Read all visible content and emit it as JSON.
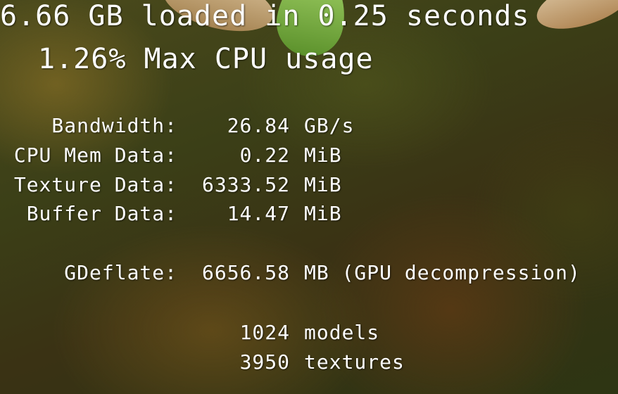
{
  "headline": {
    "loaded_text": "6.66 GB loaded in 0.25 seconds",
    "cpu_text": "1.26% Max CPU usage"
  },
  "stats": [
    {
      "label": "Bandwidth:",
      "value": "26.84",
      "unit": "GB/s"
    },
    {
      "label": "CPU Mem Data:",
      "value": "0.22",
      "unit": "MiB"
    },
    {
      "label": "Texture Data:",
      "value": "6333.52",
      "unit": "MiB"
    },
    {
      "label": "Buffer Data:",
      "value": "14.47",
      "unit": "MiB"
    }
  ],
  "gdeflate": {
    "label": "GDeflate:",
    "value": "6656.58",
    "unit": "MB (GPU decompression)"
  },
  "counts": [
    {
      "value": "1024",
      "unit": "models"
    },
    {
      "value": "3950",
      "unit": "textures"
    }
  ]
}
